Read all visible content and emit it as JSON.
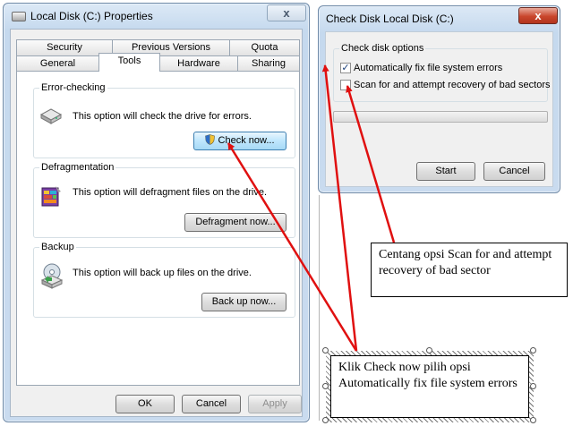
{
  "properties_window": {
    "title": "Local Disk (C:) Properties",
    "close_label": "x",
    "tabs_row1": [
      "Security",
      "Previous Versions",
      "Quota"
    ],
    "tabs_row2": [
      "General",
      "Tools",
      "Hardware",
      "Sharing"
    ],
    "active_tab": "Tools",
    "error_checking": {
      "group_label": "Error-checking",
      "description": "This option will check the drive for errors.",
      "button_label": "Check now..."
    },
    "defragmentation": {
      "group_label": "Defragmentation",
      "description": "This option will defragment files on the drive.",
      "button_label": "Defragment now..."
    },
    "backup": {
      "group_label": "Backup",
      "description": "This option will back up files on the drive.",
      "button_label": "Back up now..."
    },
    "footer": {
      "ok_label": "OK",
      "cancel_label": "Cancel",
      "apply_label": "Apply"
    }
  },
  "checkdisk_window": {
    "title": "Check Disk Local Disk (C:)",
    "close_label": "x",
    "group_label": "Check disk options",
    "option_auto_fix": {
      "label": "Automatically fix file system errors",
      "checked": true
    },
    "option_scan_recover": {
      "label": "Scan for and attempt recovery of bad sectors",
      "checked": false
    },
    "start_label": "Start",
    "cancel_label": "Cancel"
  },
  "annotations": {
    "callout_top": "Centang opsi Scan for and attempt recovery of bad sector",
    "callout_bottom": "Klik Check now pilih opsi Automatically fix file system errors",
    "arrow_color": "#e01010"
  },
  "colors": {
    "window_frame": "#c5d9ee",
    "close_button": "#c9462c",
    "panel": "#f0f0f0"
  }
}
